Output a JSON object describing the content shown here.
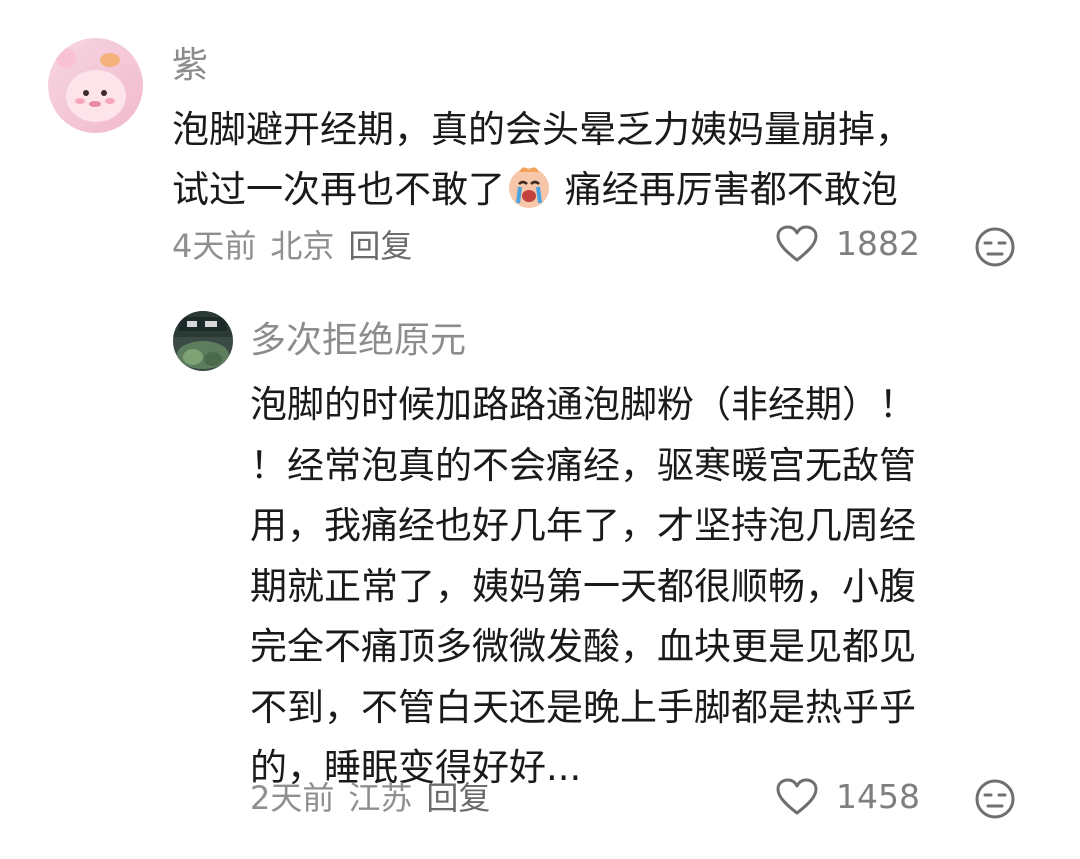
{
  "comments": [
    {
      "username": "紫",
      "text_lines": [
        "泡脚避开经期，真的会头晕乏力姨妈量崩掉，",
        "试过一次再也不敢了",
        " 痛经再厉害都不敢泡"
      ],
      "time": "4天前",
      "location": "北京",
      "reply_label": "回复",
      "likes": "1882"
    },
    {
      "username": "多次拒绝原元",
      "text_lines": [
        "泡脚的时候加路路通泡脚粉（非经期）！",
        "！经常泡真的不会痛经，驱寒暖宫无敌管",
        "用，我痛经也好几年了，才坚持泡几周经",
        "期就正常了，姨妈第一天都很顺畅，小腹",
        "完全不痛顶多微微发酸，血块更是见都见",
        "不到，不管白天还是晚上手脚都是热乎乎",
        "的，睡眠变得好好..."
      ],
      "time": "2天前",
      "location": "江苏",
      "reply_label": "回复",
      "likes": "1458"
    }
  ],
  "icons": {
    "like": "heart-outline-icon",
    "dislike": "neutral-face-icon",
    "emoji": "crying-face-emoji"
  },
  "colors": {
    "text": "#1a1a1a",
    "muted": "#8f8f8f",
    "icon": "#6f6f6f"
  }
}
